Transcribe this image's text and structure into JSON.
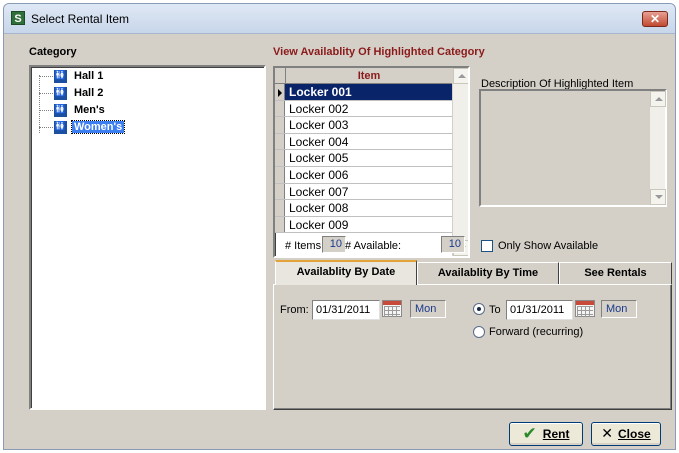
{
  "window": {
    "title": "Select Rental Item",
    "close_glyph": "✕",
    "app_icon": "S"
  },
  "category": {
    "label": "Category",
    "items": [
      {
        "label": "Hall 1",
        "icon": "restroom-icon",
        "selected": false
      },
      {
        "label": "Hall 2",
        "icon": "restroom-icon",
        "selected": false
      },
      {
        "label": "Men's",
        "icon": "restroom-icon",
        "selected": false
      },
      {
        "label": "Women's",
        "icon": "restroom-icon",
        "selected": true
      }
    ]
  },
  "availability": {
    "heading": "View Availablity Of Highlighted Category",
    "column_header": "Item",
    "rows": [
      "Locker 001",
      "Locker 002",
      "Locker 003",
      "Locker 004",
      "Locker 005",
      "Locker 006",
      "Locker 007",
      "Locker 008",
      "Locker 009"
    ],
    "selected_row": 0
  },
  "description": {
    "label": "Description Of Highlighted Item"
  },
  "counts": {
    "items_label": "# Items:",
    "items_value": "10",
    "available_label": "# Available:",
    "available_value": "10",
    "only_show_label": "Only Show Available",
    "only_show_checked": false
  },
  "tabs": [
    {
      "label": "Availablity By Date",
      "active": true
    },
    {
      "label": "Availablity By Time",
      "active": false
    },
    {
      "label": "See Rentals",
      "active": false
    }
  ],
  "date_tab": {
    "from_label": "From:",
    "from_date": "01/31/2011",
    "from_day": "Mon",
    "to_label": "To",
    "to_date": "01/31/2011",
    "to_day": "Mon",
    "forward_label": "Forward (recurring)",
    "selected_option": "to"
  },
  "buttons": {
    "rent_label": "Rent",
    "close_label": "Close"
  },
  "colors": {
    "selection": "#0a246a",
    "heading_red": "#8b1a1a",
    "value_blue": "#1b3a8c",
    "window_face": "#d4d0c8"
  }
}
